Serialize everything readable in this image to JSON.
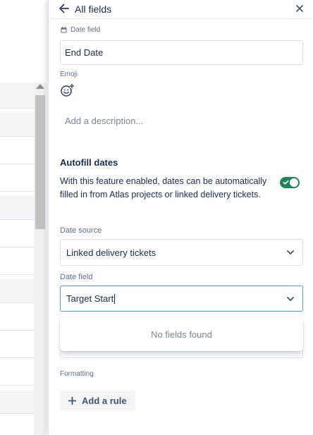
{
  "header": {
    "title": "All fields",
    "back_icon": "arrow-left-icon",
    "close_icon": "close-icon"
  },
  "field": {
    "type_label": "Date field",
    "type_icon": "calendar-icon",
    "name_value": "End Date"
  },
  "emoji": {
    "label": "Emoji",
    "icon": "add-emoji-icon"
  },
  "description": {
    "placeholder": "Add a description..."
  },
  "autofill": {
    "title": "Autofill dates",
    "text": "With this feature enabled, dates can be automatically filled in from Atlas projects or linked delivery tickets.",
    "toggle_on": true,
    "toggle_color": "#1f845a"
  },
  "date_source": {
    "label": "Date source",
    "selected": "Linked delivery tickets"
  },
  "date_field": {
    "label": "Date field",
    "input_value": "Target Start",
    "dropdown_empty": "No fields found"
  },
  "formatting": {
    "label": "Formatting",
    "add_rule_label": "Add a rule"
  },
  "colors": {
    "accent_focus": "#4c9aff",
    "text": "#172b4d",
    "muted": "#5e6c84"
  }
}
